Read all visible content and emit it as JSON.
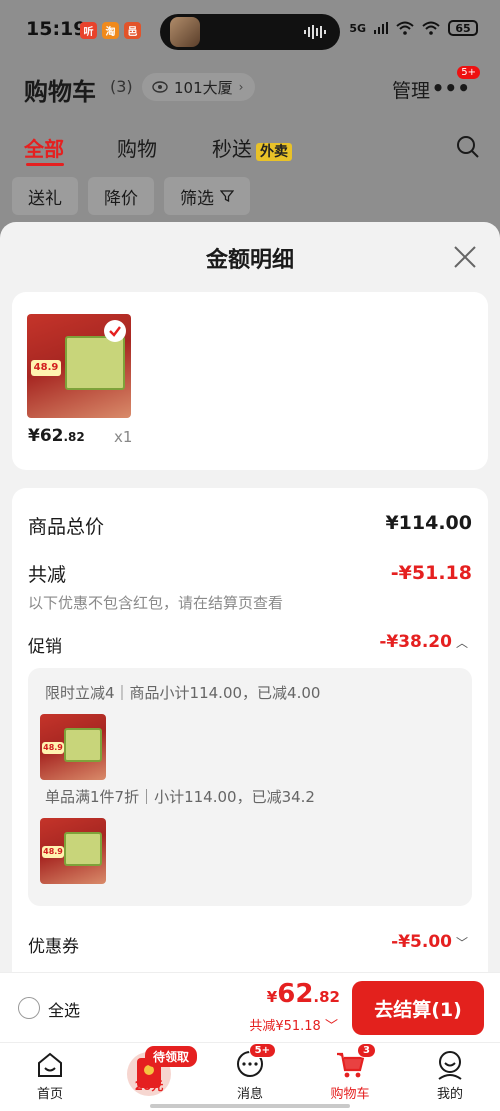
{
  "status_bar": {
    "time": "15:19",
    "app_badges": [
      {
        "text": "听",
        "color": "#e8432c"
      },
      {
        "text": "淘",
        "color": "#f08a1c"
      },
      {
        "text": "邑",
        "color": "#e2532a"
      }
    ],
    "network": "5G",
    "battery": "65"
  },
  "header": {
    "title": "购物车",
    "count": "(3)",
    "address": "101大厦",
    "manage": "管理",
    "more_badge": "5+"
  },
  "tabs": [
    {
      "label": "全部",
      "active": true
    },
    {
      "label": "购物",
      "active": false
    },
    {
      "label": "秒送",
      "active": false,
      "tag": "外卖"
    }
  ],
  "filters": [
    "送礼",
    "降价",
    "筛选"
  ],
  "sheet": {
    "title": "金额明细",
    "product": {
      "thumb_price": "48.9",
      "price_yen": "¥62",
      "price_dec": ".82",
      "qty": "x1"
    },
    "total_label": "商品总价",
    "total_value": "¥114.00",
    "reduce_label": "共减",
    "reduce_value": "-¥51.18",
    "reduce_note": "以下优惠不包含红包，请在结算页查看",
    "promo_label": "促销",
    "promo_value": "-¥38.20",
    "promo_lines": [
      "限时立减4｜商品小计114.00，已减4.00",
      "单品满1件7折｜小计114.00，已减34.2"
    ],
    "coupon_label": "优惠券",
    "coupon_value": "-¥5.00"
  },
  "checkout": {
    "select_all": "全选",
    "total_yen": "¥",
    "total_int": "62",
    "total_dec": ".82",
    "saved": "共减¥51.18",
    "pay_button": "去结算(1)"
  },
  "bottom_nav": {
    "redpack_tag": "待领取",
    "redpack_amount": "20元",
    "items": [
      {
        "label": "首页",
        "icon": "home-icon"
      },
      {
        "label": "消息",
        "icon": "message-icon",
        "badge": "5+"
      },
      {
        "label": "购物车",
        "icon": "cart-icon",
        "badge": "3",
        "active": true
      },
      {
        "label": "我的",
        "icon": "profile-icon"
      }
    ]
  },
  "colors": {
    "accent": "#e52020",
    "sheet_bg": "#f2f2f2",
    "dim_bg": "#8e8e8e"
  }
}
